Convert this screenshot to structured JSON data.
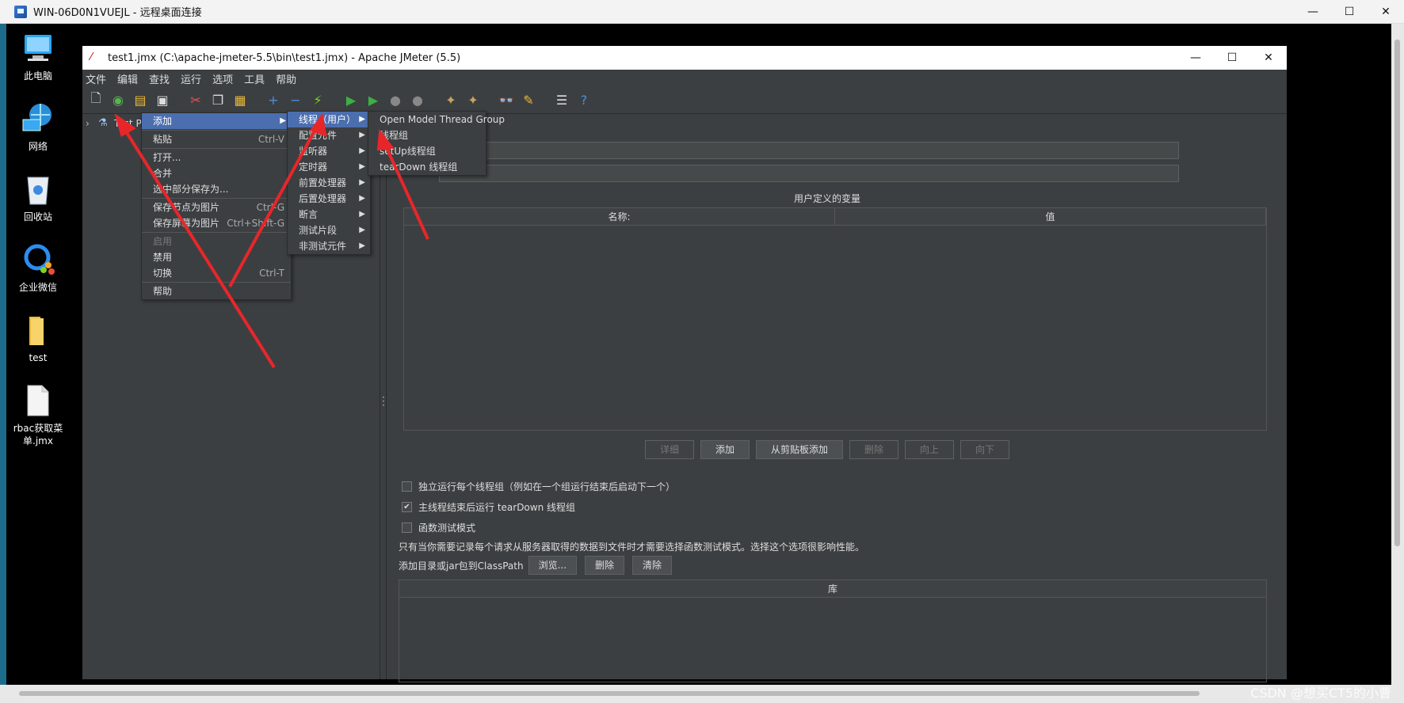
{
  "rdp": {
    "title": "WIN-06D0N1VUEJL - 远程桌面连接",
    "min": "—",
    "max": "☐",
    "close": "✕"
  },
  "desktop_icons": [
    {
      "label": "此电脑",
      "icon": "computer-icon"
    },
    {
      "label": "网络",
      "icon": "network-icon"
    },
    {
      "label": "回收站",
      "icon": "recycle-bin-icon"
    },
    {
      "label": "企业微信",
      "icon": "wecom-icon"
    },
    {
      "label": "test",
      "icon": "folder-icon"
    },
    {
      "label": "rbac获取菜单.jmx",
      "icon": "file-icon"
    }
  ],
  "jmeter": {
    "title": "test1.jmx (C:\\apache-jmeter-5.5\\bin\\test1.jmx) - Apache JMeter (5.5)",
    "menus": [
      "文件",
      "编辑",
      "查找",
      "运行",
      "选项",
      "工具",
      "帮助"
    ],
    "tree_root": "Test Pla",
    "vars_label": "用户定义的变量",
    "col_name": "名称:",
    "col_value": "值",
    "buttons": {
      "detail": "详细",
      "add": "添加",
      "add_clipboard": "从剪贴板添加",
      "delete": "删除",
      "up": "向上",
      "down": "向下"
    },
    "checks": [
      {
        "label": "独立运行每个线程组（例如在一个组运行结束后启动下一个）",
        "checked": false
      },
      {
        "label": "主线程结束后运行 tearDown 线程组",
        "checked": true
      },
      {
        "label": "函数测试模式",
        "checked": false
      }
    ],
    "note": "只有当你需要记录每个请求从服务器取得的数据到文件时才需要选择函数测试模式。选择这个选项很影响性能。",
    "classpath_label": "添加目录或jar包到ClassPath",
    "cp_browse": "浏览...",
    "cp_delete": "删除",
    "cp_clear": "清除",
    "lib_header": "库"
  },
  "context_menu": [
    {
      "label": "添加",
      "shortcut": "",
      "submenu": true,
      "selected": true,
      "disabled": false
    },
    {
      "label": "粘贴",
      "shortcut": "Ctrl-V"
    },
    {
      "label": "打开..."
    },
    {
      "label": "合并"
    },
    {
      "label": "选中部分保存为..."
    },
    {
      "label": "保存节点为图片",
      "shortcut": "Ctrl-G"
    },
    {
      "label": "保存屏幕为图片",
      "shortcut": "Ctrl+Shift-G"
    },
    {
      "label": "启用",
      "disabled": true
    },
    {
      "label": "禁用"
    },
    {
      "label": "切换",
      "shortcut": "Ctrl-T"
    },
    {
      "label": "帮助"
    }
  ],
  "add_submenu": [
    {
      "label": "线程（用户）",
      "selected": true
    },
    {
      "label": "配置元件"
    },
    {
      "label": "监听器"
    },
    {
      "label": "定时器"
    },
    {
      "label": "前置处理器"
    },
    {
      "label": "后置处理器"
    },
    {
      "label": "断言"
    },
    {
      "label": "测试片段"
    },
    {
      "label": "非测试元件"
    }
  ],
  "thread_submenu": [
    {
      "label": "Open Model Thread Group"
    },
    {
      "label": "线程组"
    },
    {
      "label": "setUp线程组"
    },
    {
      "label": "tearDown 线程组"
    }
  ],
  "watermark": "CSDN @想买CT5的小曹",
  "colors": {
    "arrow": "#e8262a",
    "selection": "#4b6eaf",
    "panel": "#3c3f41"
  }
}
